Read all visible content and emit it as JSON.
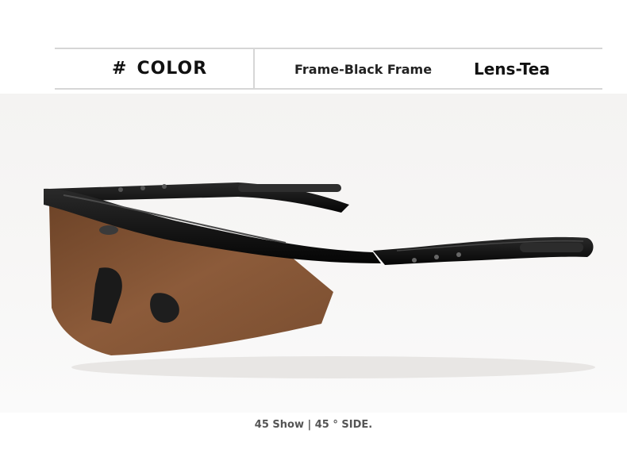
{
  "header": {
    "hash": "#",
    "title": "COLOR",
    "frame": "Frame-Black Frame",
    "lens": "Lens-Tea"
  },
  "photo": {
    "subject": "sunglasses-icon",
    "frame_color": "#111111",
    "lens_color": "#8a5a3a"
  },
  "caption": "45 Show | 45 ° SIDE."
}
